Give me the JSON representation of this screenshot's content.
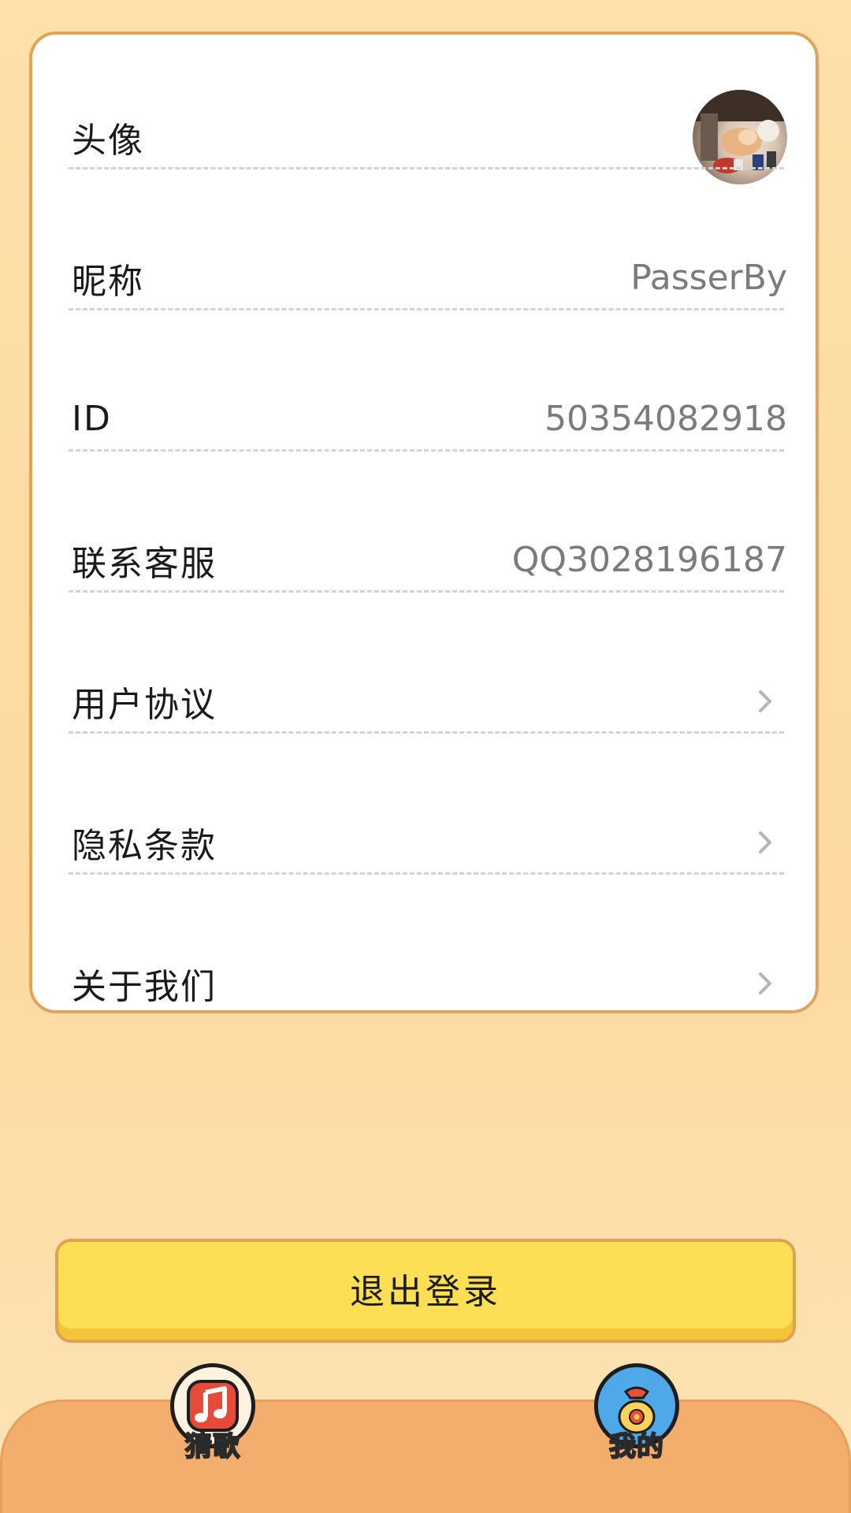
{
  "profile": {
    "rows": [
      {
        "label": "头像"
      },
      {
        "label": "昵称",
        "value": "PasserBy"
      },
      {
        "label": "ID",
        "value": "50354082918"
      },
      {
        "label": "联系客服",
        "value": "QQ3028196187"
      },
      {
        "label": "用户协议"
      },
      {
        "label": "隐私条款"
      },
      {
        "label": "关于我们"
      }
    ]
  },
  "actions": {
    "logout_label": "退出登录"
  },
  "tabbar": {
    "tabs": [
      {
        "label": "猜歌",
        "icon": "music-note-icon"
      },
      {
        "label": "我的",
        "icon": "money-bag-icon"
      }
    ]
  },
  "colors": {
    "background": "#fddaa2",
    "card_border": "#e1a25a",
    "logout_button": "#fddf56",
    "tabbar": "#f3ad6d",
    "value_text": "#7b7b7b"
  }
}
